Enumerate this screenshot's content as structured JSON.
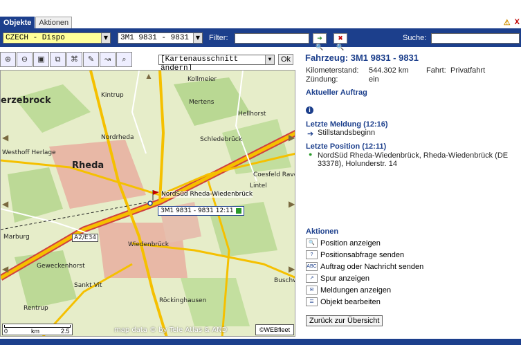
{
  "tabs": [
    {
      "label": "Objekte",
      "active": true
    },
    {
      "label": "Aktionen",
      "active": false
    }
  ],
  "toolbar": {
    "group_select": "CZECH - Dispo",
    "vehicle_select": "3M1 9831 - 9831",
    "filter_label": "Filter:",
    "search_label": "Suche:"
  },
  "map": {
    "view_select": "[Kartenausschnitt ändern]",
    "ok_label": "Ok",
    "labels": {
      "kolmeier": "Kollmeier",
      "kintrup": "Kintrup",
      "erzebrock": "erzebrock",
      "mertens": "Mertens",
      "nordrheda": "Nordrheda",
      "hellhorst": "Hellhorst",
      "westhoff": "Westhoff Herlage",
      "schledebrueck": "Schledebrück",
      "rheda": "Rheda",
      "ravensberg": "Coesfeld Ravensberg",
      "lintel": "Lintel",
      "a2": "A2/E34",
      "marburg": "Marburg",
      "wiedenbrueck": "Wiedenbrück",
      "geweckenhorst": "Geweckenhorst",
      "sanktvit": "Sankt Vit",
      "buschweg": "Buschweg",
      "rentrup": "Rentrup",
      "roeckinghausen": "Röckinghausen"
    },
    "position_label": "NordSüd Rheda-Wiedenbrück",
    "vehicle_label": "3M1 9831 - 9831 12:11",
    "scale": {
      "left": "0",
      "unit": "km",
      "right": "2.5"
    },
    "copyright": "map data © by Tele Atlas & AND",
    "logo": "©WEBfleet"
  },
  "vehicle": {
    "title": "Fahrzeug: 3M1 9831 - 9831",
    "odometer_label": "Kilometerstand:",
    "odometer_value": "544.302 km",
    "trip_label": "Fahrt:",
    "trip_value": "Privatfahrt",
    "ignition_label": "Zündung:",
    "ignition_value": "ein",
    "current_order": "Aktueller Auftrag",
    "last_message_title": "Letzte Meldung (12:16)",
    "last_message": "Stillstandsbeginn",
    "last_position_title": "Letzte Position (12:11)",
    "last_position_line1": "NordSüd Rheda-Wiedenbrück, Rheda-Wiedenbrück (DE",
    "last_position_line2": "33378), Holunderstr. 14"
  },
  "actions": {
    "title": "Aktionen",
    "items": [
      "Position anzeigen",
      "Positionsabfrage senden",
      "Auftrag oder Nachricht senden",
      "Spur anzeigen",
      "Meldungen anzeigen",
      "Objekt bearbeiten"
    ],
    "back_button": "Zurück zur Übersicht"
  }
}
